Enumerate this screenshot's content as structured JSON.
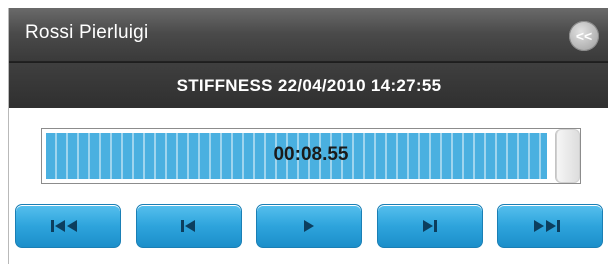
{
  "header": {
    "title": "Rossi Pierluigi",
    "collapse_label": "<<"
  },
  "session": {
    "label": "STIFFNESS 22/04/2010 14:27:55"
  },
  "player": {
    "time": "00:08.55",
    "progress_fraction": 0.99,
    "accent_color": "#2ea4dc",
    "controls": [
      {
        "name": "skip-to-start-button",
        "icon": "skip-to-start-icon"
      },
      {
        "name": "previous-button",
        "icon": "previous-icon"
      },
      {
        "name": "play-button",
        "icon": "play-icon"
      },
      {
        "name": "next-button",
        "icon": "next-icon"
      },
      {
        "name": "skip-to-end-button",
        "icon": "skip-to-end-icon"
      }
    ]
  }
}
